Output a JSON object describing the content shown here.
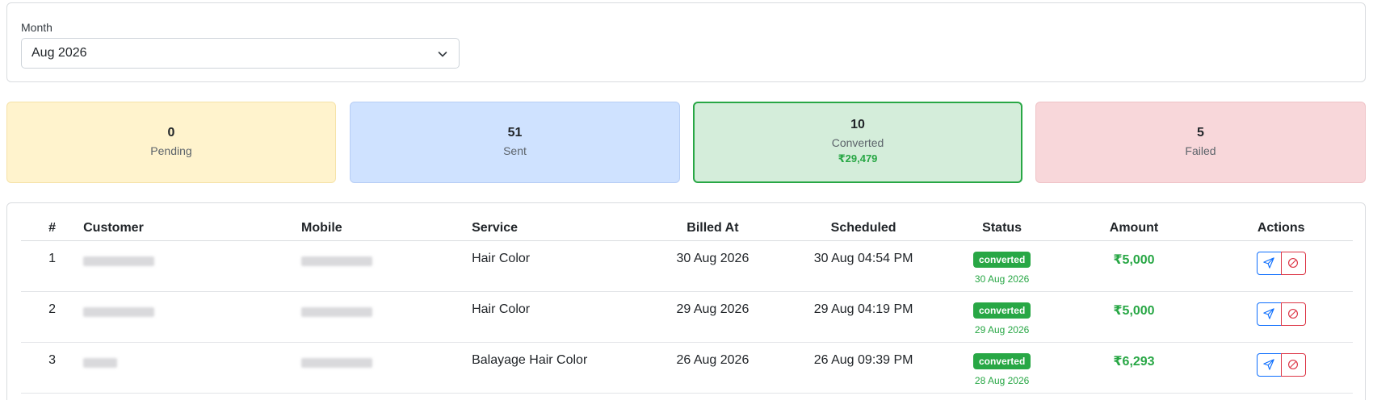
{
  "filter": {
    "label": "Month",
    "selected": "Aug 2026"
  },
  "stats": {
    "pending": {
      "count": "0",
      "label": "Pending"
    },
    "sent": {
      "count": "51",
      "label": "Sent"
    },
    "converted": {
      "count": "10",
      "label": "Converted",
      "amount": "₹29,479"
    },
    "failed": {
      "count": "5",
      "label": "Failed"
    }
  },
  "table": {
    "headers": [
      "#",
      "Customer",
      "Mobile",
      "Service",
      "Billed At",
      "Scheduled",
      "Status",
      "Amount",
      "Actions"
    ],
    "rows": [
      {
        "num": "1",
        "service": "Hair Color",
        "billed_at": "30 Aug 2026",
        "scheduled": "30 Aug 04:54 PM",
        "status": "converted",
        "status_date": "30 Aug 2026",
        "amount": "₹5,000"
      },
      {
        "num": "2",
        "service": "Hair Color",
        "billed_at": "29 Aug 2026",
        "scheduled": "29 Aug 04:19 PM",
        "status": "converted",
        "status_date": "29 Aug 2026",
        "amount": "₹5,000"
      },
      {
        "num": "3",
        "service": "Balayage Hair Color",
        "billed_at": "26 Aug 2026",
        "scheduled": "26 Aug 09:39 PM",
        "status": "converted",
        "status_date": "28 Aug 2026",
        "amount": "₹6,293"
      }
    ]
  },
  "icons": {
    "chevron": "chevron-down-icon",
    "send": "send-icon",
    "cancel": "cancel-icon"
  },
  "colors": {
    "success": "#28a745",
    "primary": "#0d6efd",
    "danger": "#dc3545",
    "pending_bg": "#fff3cd",
    "sent_bg": "#cfe2ff",
    "converted_bg": "#d4edda",
    "failed_bg": "#f8d7da"
  }
}
